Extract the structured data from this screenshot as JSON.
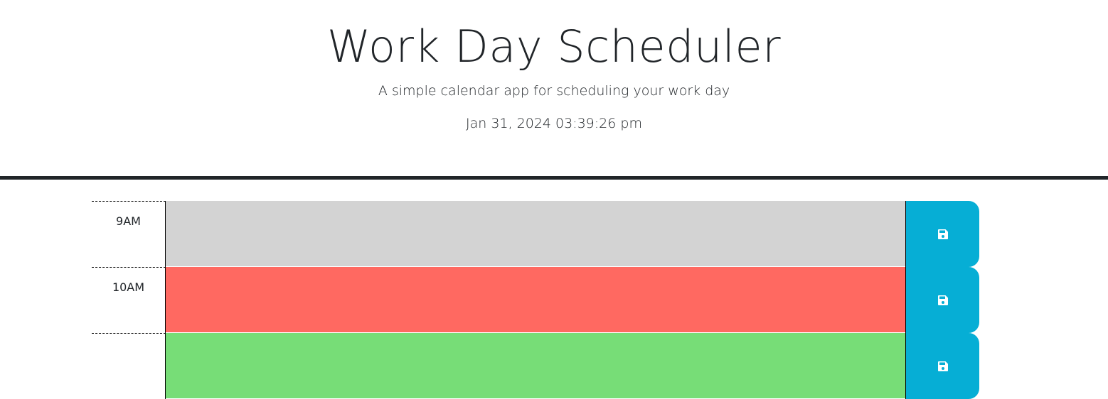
{
  "header": {
    "title": "Work Day Scheduler",
    "subtitle": "A simple calendar app for scheduling your work day",
    "current_datetime": "Jan 31, 2024 03:39:26 pm"
  },
  "time_blocks": [
    {
      "hour": "9AM",
      "status": "past",
      "text": "",
      "save_icon": "floppy-disk-icon"
    },
    {
      "hour": "10AM",
      "status": "present",
      "text": "",
      "save_icon": "floppy-disk-icon"
    },
    {
      "hour": "",
      "status": "future",
      "text": "",
      "save_icon": "floppy-disk-icon"
    }
  ],
  "colors": {
    "past": "#d3d3d3",
    "present": "#ff6961",
    "future": "#77dd77",
    "save_button": "#06aed5",
    "header_border": "#212529"
  }
}
